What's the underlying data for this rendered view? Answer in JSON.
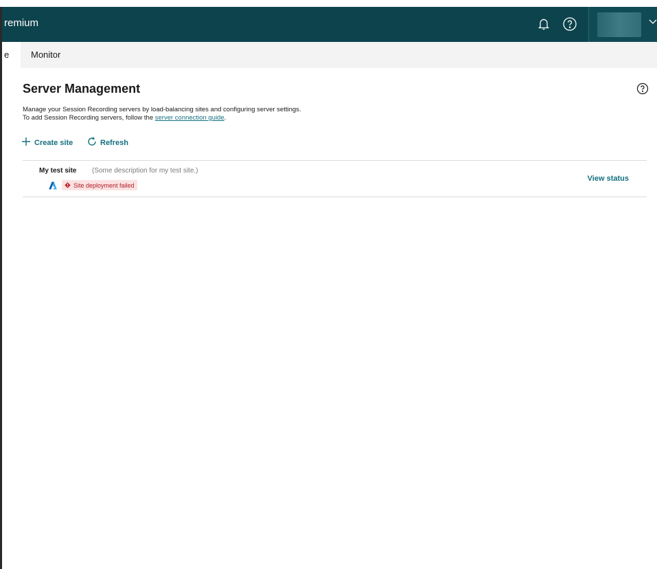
{
  "header": {
    "product_name": "remium",
    "icons": [
      "bell-icon",
      "help-icon",
      "chevron-down-icon"
    ],
    "colors": {
      "topbar_bg": "#0d434d"
    }
  },
  "nav": {
    "prev_tab_label": "e",
    "monitor_label": "Monitor"
  },
  "page": {
    "title": "Server Management",
    "description_line1": "Manage your Session Recording servers by load-balancing sites and configuring server settings.",
    "description_line2_prefix": "To add Session Recording servers, follow the ",
    "description_link": "server connection guide",
    "description_line2_suffix": "."
  },
  "actions": {
    "create_site": "Create site",
    "refresh": "Refresh"
  },
  "sites": [
    {
      "name": "My test site",
      "description": "(Some description for my test site.)",
      "provider_icon": "azure-icon",
      "status": "Site deployment failed",
      "view_status": "View status"
    }
  ],
  "colors": {
    "accent": "#13707f",
    "error_text": "#b01e28",
    "error_bg": "#fbe2e2"
  }
}
